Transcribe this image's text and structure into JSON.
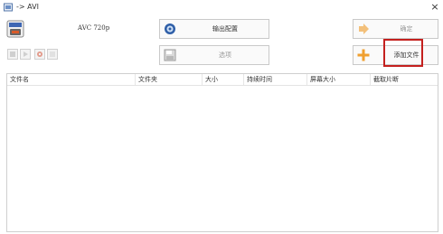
{
  "window": {
    "title": "-> AVI",
    "close_glyph": "×"
  },
  "format": {
    "label": "AVC 720p",
    "icon": "avi-format-icon"
  },
  "toolbar": {
    "output_settings_label": "输出配置",
    "output_settings_icon": "gear-icon",
    "options_label": "选项",
    "options_icon": "save-icon",
    "ok_label": "确定",
    "ok_icon": "arrow-right-icon",
    "add_file_label": "添加文件",
    "add_file_icon": "plus-icon"
  },
  "mini_toolbar": [
    {
      "name": "remove-icon"
    },
    {
      "name": "play-icon"
    },
    {
      "name": "settings-icon"
    },
    {
      "name": "list-icon"
    }
  ],
  "file_table": {
    "columns": [
      "文件名",
      "文件夹",
      "大小",
      "持续时间",
      "屏幕大小",
      "截取片断"
    ],
    "rows": []
  },
  "colors": {
    "highlight": "#c4201e",
    "add_accent": "#f0a030",
    "ok_accent": "#f3c07a"
  }
}
